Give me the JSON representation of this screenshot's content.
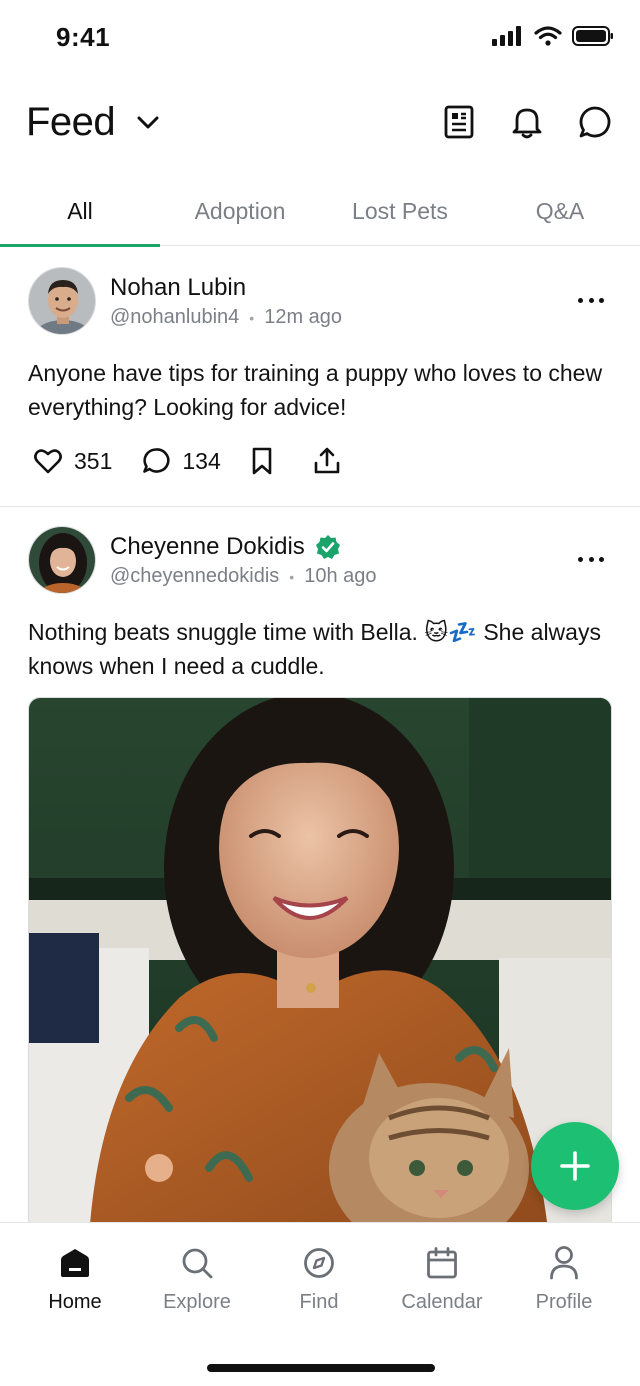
{
  "status_bar": {
    "time": "9:41"
  },
  "header": {
    "title": "Feed",
    "icons": [
      "chevron-down-icon",
      "news-icon",
      "bell-icon",
      "chat-icon"
    ]
  },
  "tabs": [
    {
      "label": "All",
      "active": true
    },
    {
      "label": "Adoption",
      "active": false
    },
    {
      "label": "Lost Pets",
      "active": false
    },
    {
      "label": "Q&A",
      "active": false
    }
  ],
  "posts": [
    {
      "author": "Nohan Lubin",
      "handle": "@nohanlubin4",
      "time": "12m ago",
      "verified": false,
      "text": "Anyone have tips for training a puppy who loves to chew everything? Looking for advice!",
      "likes": "351",
      "comments": "134"
    },
    {
      "author": "Cheyenne Dokidis",
      "handle": "@cheyennedokidis",
      "time": "10h ago",
      "verified": true,
      "text": "Nothing beats snuggle time with Bella. 🐱💤 She always knows when I need a cuddle.",
      "image": "photo of smiling woman in orange floral blouse holding a fluffy tabby kitten"
    }
  ],
  "bottom_nav": [
    {
      "label": "Home",
      "icon": "home-icon",
      "active": true
    },
    {
      "label": "Explore",
      "icon": "search-icon",
      "active": false
    },
    {
      "label": "Find",
      "icon": "compass-icon",
      "active": false
    },
    {
      "label": "Calendar",
      "icon": "calendar-icon",
      "active": false
    },
    {
      "label": "Profile",
      "icon": "user-icon",
      "active": false
    }
  ],
  "colors": {
    "accent": "#1aa36a",
    "fab": "#1dbf73",
    "verified": "#1aa36a",
    "muted_text": "#7b7f86"
  }
}
